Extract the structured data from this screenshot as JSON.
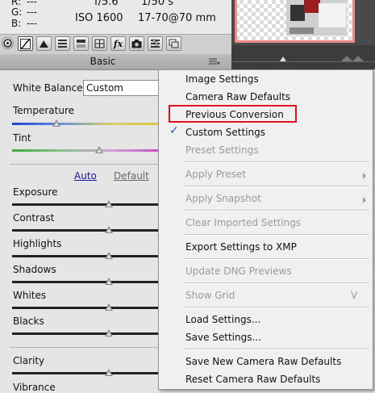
{
  "info": {
    "r_label": "R:",
    "r_value": "---",
    "g_label": "G:",
    "g_value": "---",
    "b_label": "B:",
    "b_value": "---",
    "aperture": "f/5.6",
    "shutter": "1/50 s",
    "iso": "ISO 1600",
    "lens": "17-70@70 mm"
  },
  "panel": {
    "title": "Basic",
    "white_balance_label": "White Balance:",
    "white_balance_value": "Custom",
    "temperature_label": "Temperature",
    "tint_label": "Tint",
    "auto_link": "Auto",
    "default_link": "Default",
    "sliders": [
      {
        "label": "Exposure"
      },
      {
        "label": "Contrast"
      },
      {
        "label": "Highlights"
      },
      {
        "label": "Shadows"
      },
      {
        "label": "Whites"
      },
      {
        "label": "Blacks"
      },
      {
        "label": "Clarity"
      },
      {
        "label": "Vibrance"
      }
    ]
  },
  "menu": {
    "items": [
      {
        "label": "Image Settings",
        "enabled": true
      },
      {
        "label": "Camera Raw Defaults",
        "enabled": true
      },
      {
        "label": "Previous Conversion",
        "enabled": true,
        "highlighted": true
      },
      {
        "label": "Custom Settings",
        "enabled": true,
        "checked": true
      },
      {
        "label": "Preset Settings",
        "enabled": false
      },
      {
        "label": "Apply Preset",
        "enabled": false,
        "submenu": true
      },
      {
        "label": "Apply Snapshot",
        "enabled": false,
        "submenu": true
      },
      {
        "label": "Clear Imported Settings",
        "enabled": false
      },
      {
        "label": "Export Settings to XMP",
        "enabled": true
      },
      {
        "label": "Update DNG Previews",
        "enabled": false
      },
      {
        "label": "Show Grid",
        "enabled": false,
        "shortcut": "V"
      },
      {
        "label": "Load Settings...",
        "enabled": true
      },
      {
        "label": "Save Settings...",
        "enabled": true
      },
      {
        "label": "Save New Camera Raw Defaults",
        "enabled": true
      },
      {
        "label": "Reset Camera Raw Defaults",
        "enabled": true
      }
    ],
    "checkmark": "✓"
  },
  "icons": {
    "fx": "fx"
  },
  "colors": {
    "highlight_box": "#e0141c",
    "link_blue": "#1a1aa0",
    "checkmark_blue": "#1b56c8"
  }
}
